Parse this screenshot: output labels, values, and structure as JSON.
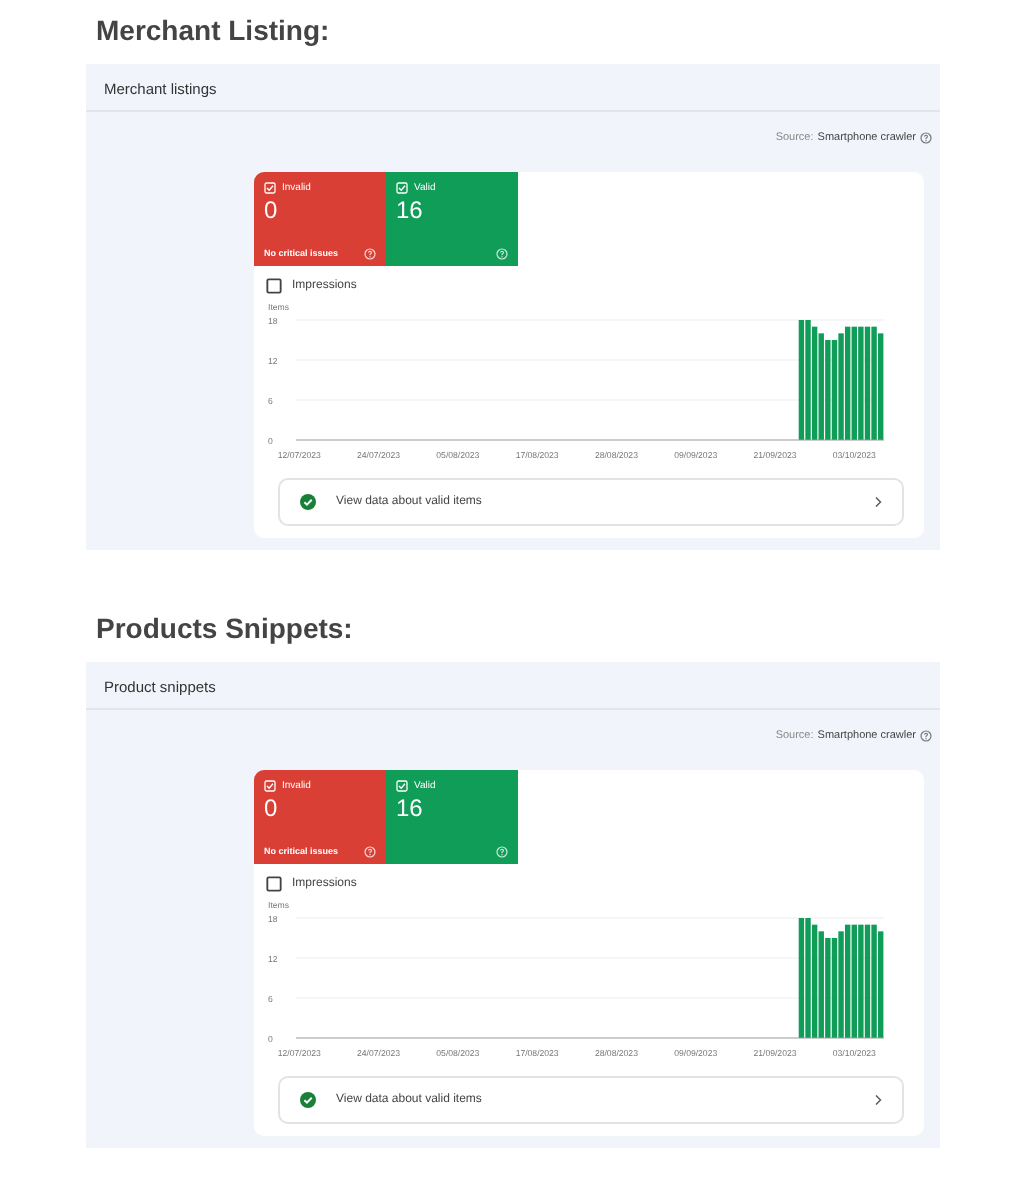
{
  "sections": [
    {
      "heading": "Merchant Listing:",
      "panel_title": "Merchant listings",
      "source_label": "Source:",
      "source_value": "Smartphone crawler",
      "tiles": [
        {
          "kind": "invalid",
          "label": "Invalid",
          "checked": true,
          "count": "0",
          "note": "No critical issues"
        },
        {
          "kind": "valid",
          "label": "Valid",
          "checked": true,
          "count": "16"
        }
      ],
      "impressions": {
        "label": "Impressions",
        "checked": false
      },
      "chart_data": {
        "type": "bar",
        "ylabel": "Items",
        "categories": [
          "12/07/2023",
          null,
          null,
          null,
          null,
          null,
          null,
          null,
          null,
          null,
          null,
          null,
          "24/07/2023",
          null,
          null,
          null,
          null,
          null,
          null,
          null,
          null,
          null,
          null,
          null,
          "05/08/2023",
          null,
          null,
          null,
          null,
          null,
          null,
          null,
          null,
          null,
          null,
          null,
          "17/08/2023",
          null,
          null,
          null,
          null,
          null,
          null,
          null,
          null,
          null,
          null,
          null,
          "28/08/2023",
          null,
          null,
          null,
          null,
          null,
          null,
          null,
          null,
          null,
          null,
          null,
          "09/09/2023",
          null,
          null,
          null,
          null,
          null,
          null,
          null,
          null,
          null,
          null,
          null,
          "21/09/2023",
          null,
          null,
          null,
          null,
          null,
          null,
          null,
          null,
          null,
          null,
          null,
          "03/10/2023",
          null,
          null,
          null,
          null
        ],
        "series": [
          {
            "color": "#0f9d58",
            "values": [
              null,
              null,
              null,
              null,
              null,
              null,
              null,
              null,
              null,
              null,
              null,
              null,
              null,
              null,
              null,
              null,
              null,
              null,
              null,
              null,
              null,
              null,
              null,
              null,
              null,
              null,
              null,
              null,
              null,
              null,
              null,
              null,
              null,
              null,
              null,
              null,
              null,
              null,
              null,
              null,
              null,
              null,
              null,
              null,
              null,
              null,
              null,
              null,
              null,
              null,
              null,
              null,
              null,
              null,
              null,
              null,
              null,
              null,
              null,
              null,
              null,
              null,
              null,
              null,
              null,
              null,
              null,
              null,
              null,
              null,
              null,
              null,
              null,
              null,
              null,
              null,
              18,
              18,
              17,
              16,
              15,
              15,
              16,
              17,
              17,
              17,
              17,
              17,
              16
            ]
          }
        ],
        "ylim": [
          0,
          18
        ],
        "yticks": [
          0,
          6,
          12,
          18
        ]
      },
      "link": {
        "label": "View data about valid items"
      }
    },
    {
      "heading": "Products Snippets:",
      "panel_title": "Product snippets",
      "source_label": "Source:",
      "source_value": "Smartphone crawler",
      "tiles": [
        {
          "kind": "invalid",
          "label": "Invalid",
          "checked": true,
          "count": "0",
          "note": "No critical issues"
        },
        {
          "kind": "valid",
          "label": "Valid",
          "checked": true,
          "count": "16"
        }
      ],
      "impressions": {
        "label": "Impressions",
        "checked": false
      },
      "chart_data": {
        "type": "bar",
        "ylabel": "Items",
        "categories": [
          "12/07/2023",
          null,
          null,
          null,
          null,
          null,
          null,
          null,
          null,
          null,
          null,
          null,
          "24/07/2023",
          null,
          null,
          null,
          null,
          null,
          null,
          null,
          null,
          null,
          null,
          null,
          "05/08/2023",
          null,
          null,
          null,
          null,
          null,
          null,
          null,
          null,
          null,
          null,
          null,
          "17/08/2023",
          null,
          null,
          null,
          null,
          null,
          null,
          null,
          null,
          null,
          null,
          null,
          "28/08/2023",
          null,
          null,
          null,
          null,
          null,
          null,
          null,
          null,
          null,
          null,
          null,
          "09/09/2023",
          null,
          null,
          null,
          null,
          null,
          null,
          null,
          null,
          null,
          null,
          null,
          "21/09/2023",
          null,
          null,
          null,
          null,
          null,
          null,
          null,
          null,
          null,
          null,
          null,
          "03/10/2023",
          null,
          null,
          null,
          null
        ],
        "series": [
          {
            "color": "#0f9d58",
            "values": [
              null,
              null,
              null,
              null,
              null,
              null,
              null,
              null,
              null,
              null,
              null,
              null,
              null,
              null,
              null,
              null,
              null,
              null,
              null,
              null,
              null,
              null,
              null,
              null,
              null,
              null,
              null,
              null,
              null,
              null,
              null,
              null,
              null,
              null,
              null,
              null,
              null,
              null,
              null,
              null,
              null,
              null,
              null,
              null,
              null,
              null,
              null,
              null,
              null,
              null,
              null,
              null,
              null,
              null,
              null,
              null,
              null,
              null,
              null,
              null,
              null,
              null,
              null,
              null,
              null,
              null,
              null,
              null,
              null,
              null,
              null,
              null,
              null,
              null,
              null,
              null,
              18,
              18,
              17,
              16,
              15,
              15,
              16,
              17,
              17,
              17,
              17,
              17,
              16
            ]
          }
        ],
        "ylim": [
          0,
          18
        ],
        "yticks": [
          0,
          6,
          12,
          18
        ]
      },
      "link": {
        "label": "View data about valid items"
      }
    }
  ]
}
